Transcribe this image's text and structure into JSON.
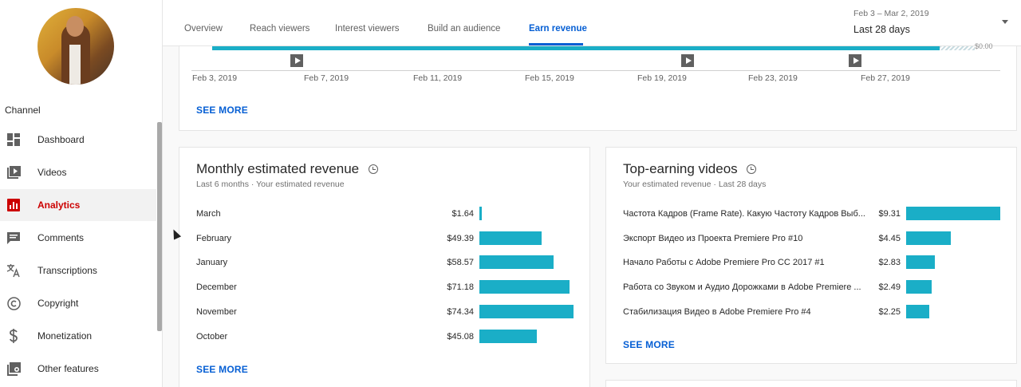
{
  "sidebar": {
    "section_label": "Channel",
    "items": [
      {
        "label": "Dashboard",
        "icon": "dashboard-icon"
      },
      {
        "label": "Videos",
        "icon": "videos-icon"
      },
      {
        "label": "Analytics",
        "icon": "analytics-icon",
        "active": true
      },
      {
        "label": "Comments",
        "icon": "comments-icon"
      },
      {
        "label": "Transcriptions",
        "icon": "translate-icon"
      },
      {
        "label": "Copyright",
        "icon": "copyright-icon"
      },
      {
        "label": "Monetization",
        "icon": "dollar-icon"
      },
      {
        "label": "Other features",
        "icon": "other-features-icon"
      }
    ]
  },
  "header": {
    "tabs": [
      {
        "label": "Overview"
      },
      {
        "label": "Reach viewers"
      },
      {
        "label": "Interest viewers"
      },
      {
        "label": "Build an audience"
      },
      {
        "label": "Earn revenue",
        "active": true
      }
    ],
    "date_range": "Feb 3 – Mar 2, 2019",
    "period": "Last 28 days"
  },
  "timeline": {
    "end_value": "$0.00",
    "ticks": [
      "Feb 3, 2019",
      "Feb 7, 2019",
      "Feb 11, 2019",
      "Feb 15, 2019",
      "Feb 19, 2019",
      "Feb 23, 2019",
      "Feb 27, 2019"
    ],
    "see_more": "SEE MORE"
  },
  "monthly": {
    "title": "Monthly estimated revenue",
    "subtitle": "Last 6 months · Your estimated revenue",
    "rows": [
      {
        "month": "March",
        "value": "$1.64"
      },
      {
        "month": "February",
        "value": "$49.39"
      },
      {
        "month": "January",
        "value": "$58.57"
      },
      {
        "month": "December",
        "value": "$71.18"
      },
      {
        "month": "November",
        "value": "$74.34"
      },
      {
        "month": "October",
        "value": "$45.08"
      }
    ],
    "see_more": "SEE MORE"
  },
  "top_earning": {
    "title": "Top-earning videos",
    "subtitle": "Your estimated revenue · Last 28 days",
    "rows": [
      {
        "video": "Частота Кадров (Frame Rate). Какую Частоту Кадров Выб...",
        "value": "$9.31"
      },
      {
        "video": "Экспорт Видео из Проекта Premiere Pro #10",
        "value": "$4.45"
      },
      {
        "video": "Начало Работы с Adobe Premiere Pro CC 2017 #1",
        "value": "$2.83"
      },
      {
        "video": "Работа со Звуком и Аудио Дорожками в Adobe Premiere ...",
        "value": "$2.49"
      },
      {
        "video": "Стабилизация Видео в Adobe Premiere Pro #4",
        "value": "$2.25"
      }
    ],
    "see_more": "SEE MORE"
  },
  "colors": {
    "accent": "#065fd4",
    "bar": "#1aaec7",
    "active_nav": "#cc0000"
  }
}
